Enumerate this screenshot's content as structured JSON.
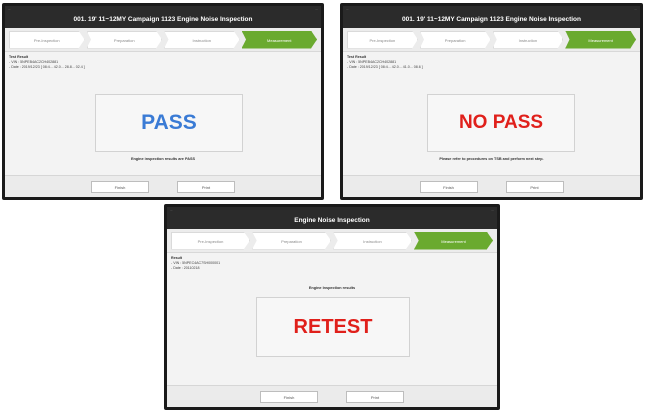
{
  "panels": [
    {
      "status_left": "...",
      "status_right": "...",
      "title": "001. 19' 11~12MY Campaign 1123 Engine Noise Inspection",
      "steps": [
        "Pre-Inspection",
        "Preparation",
        "Instruction",
        "Measurement"
      ],
      "active_step": 3,
      "section_label": "Test Result",
      "vin_line": "- VIN : 5NPEB4AC2CH402881",
      "date_line": "- Date : 2019/12/23 [ 08:4... 42.0... 28.8... 02.4 ]",
      "result": "PASS",
      "result_color": "#3a7bd5",
      "message": "Engine inspection results are PASS",
      "finish_label": "Finish",
      "print_label": "Print"
    },
    {
      "status_left": "...",
      "status_right": "...",
      "title": "001. 19' 11~12MY Campaign 1123 Engine Noise Inspection",
      "steps": [
        "Pre-Inspection",
        "Preparation",
        "Instruction",
        "Measurement"
      ],
      "active_step": 3,
      "section_label": "Test Result",
      "vin_line": "- VIN : 5NPEB4AC2CH402881",
      "date_line": "- Date : 2019/12/23 [ 08:4... 42.0... 41.0... 08.6 ]",
      "result": "NO PASS",
      "result_color": "#e0201b",
      "message": "Please refer to procedures on TSB and perform next step.",
      "finish_label": "Finish",
      "print_label": "Print"
    },
    {
      "status_left": "...",
      "status_right": "...",
      "title": "Engine Noise Inspection",
      "steps": [
        "Pre-Inspection",
        "Preparation",
        "Instruction",
        "Measurement"
      ],
      "active_step": 3,
      "section_label": "Result",
      "vin_line": "- VIN : 5NPEC4AC7SH000001",
      "date_line": "- Date : 20110218",
      "result": "RETEST",
      "result_color": "#e0201b",
      "message": "Engine Inspection results",
      "finish_label": "Finish",
      "print_label": "Print"
    }
  ]
}
